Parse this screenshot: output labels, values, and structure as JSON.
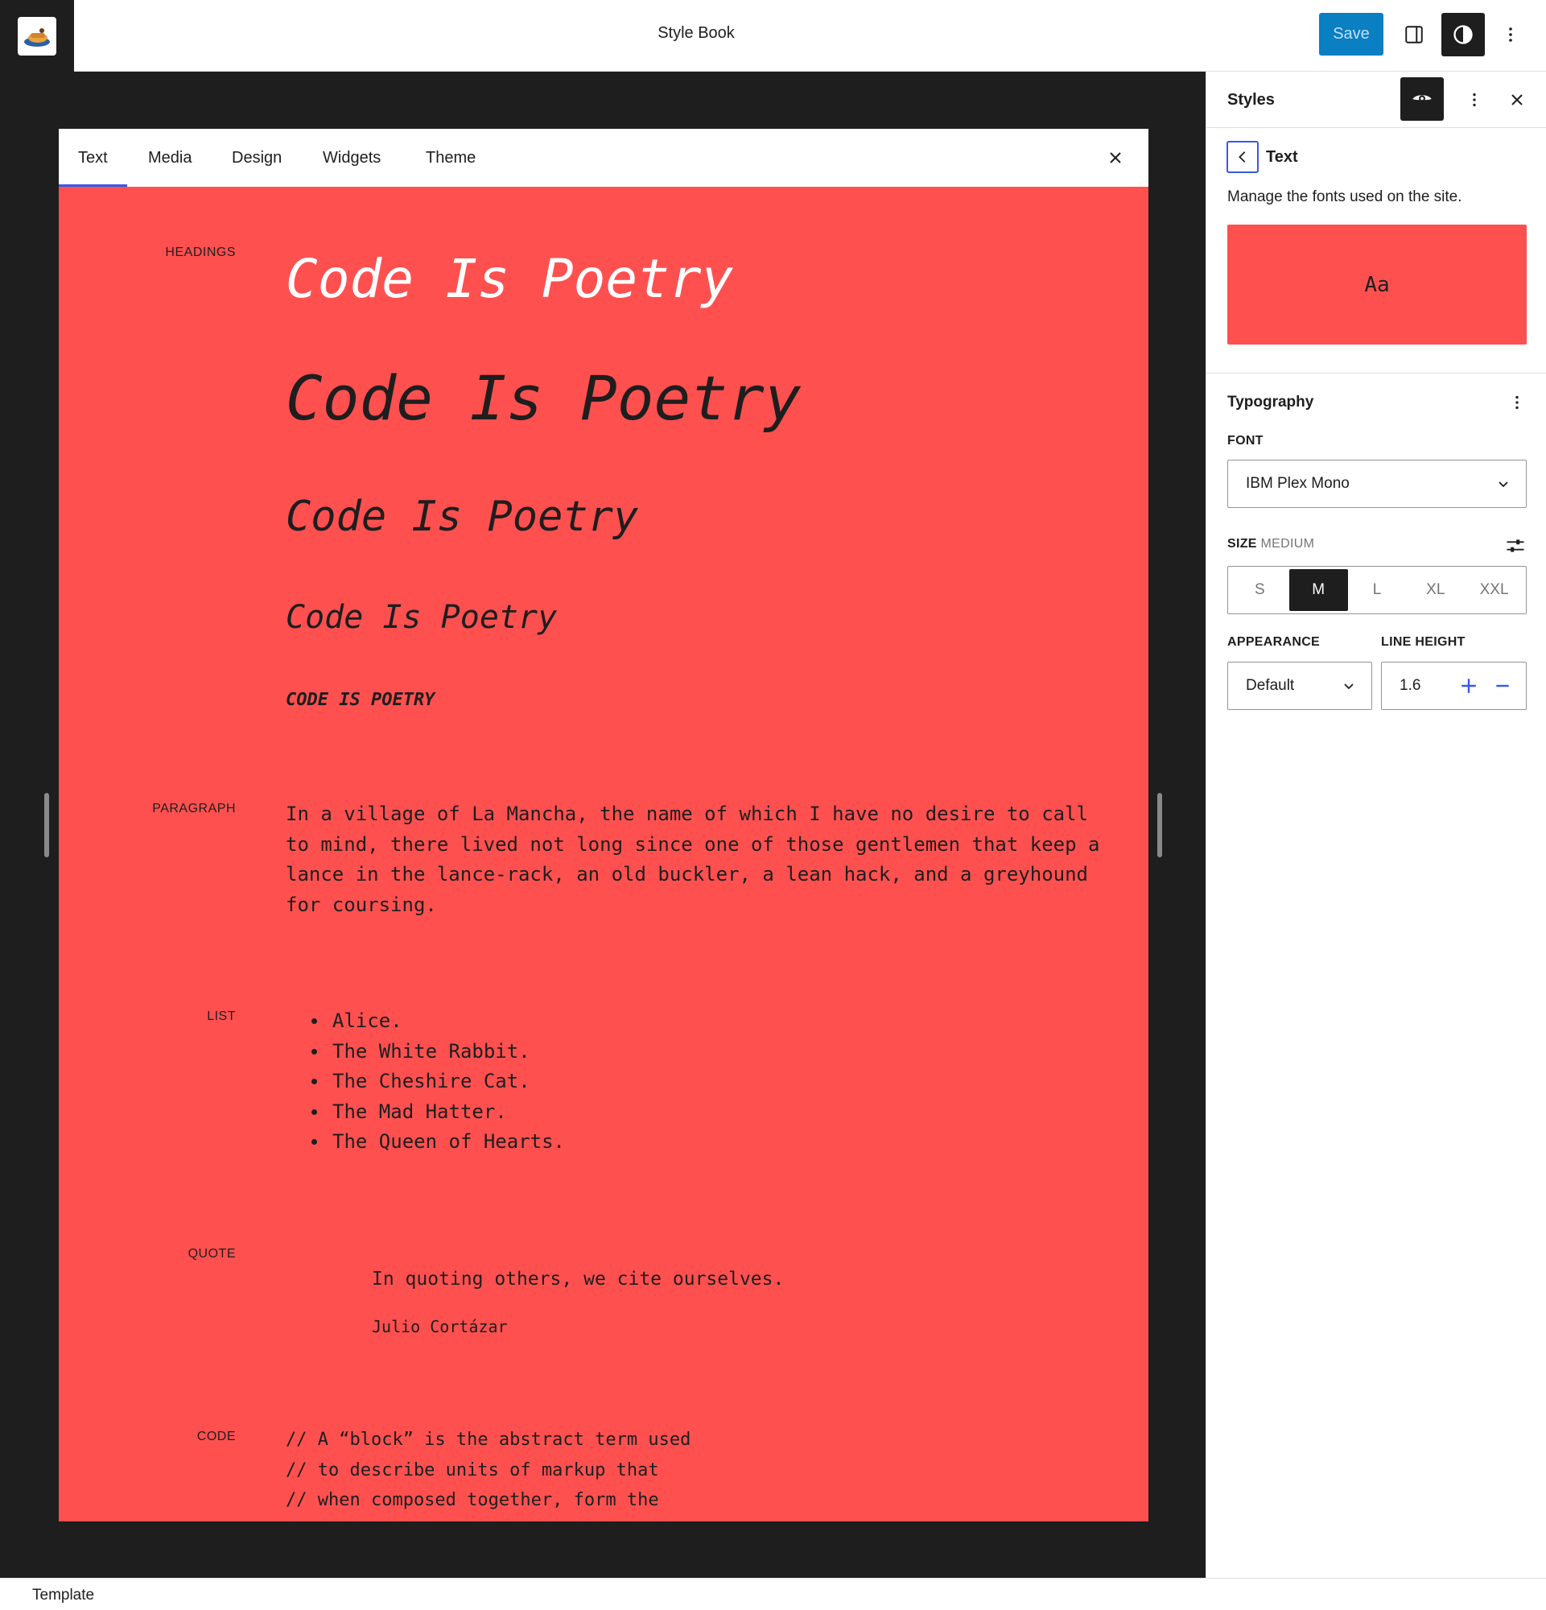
{
  "header": {
    "title": "Style Book",
    "save_label": "Save",
    "icons": [
      "site-logo",
      "sidebar-toggle-icon",
      "styles-contrast-icon",
      "more-vertical-icon"
    ]
  },
  "stylebook": {
    "tabs": [
      "Text",
      "Media",
      "Design",
      "Widgets",
      "Theme"
    ],
    "active_tab": "Text",
    "sections": {
      "headings_label": "HEADINGS",
      "headings": [
        "Code Is Poetry",
        "Code Is Poetry",
        "Code Is Poetry",
        "Code Is Poetry",
        "CODE IS POETRY"
      ],
      "paragraph_label": "PARAGRAPH",
      "paragraph": "In a village of La Mancha, the name of which I have no desire to call to mind, there lived not long since one of those gentlemen that keep a lance in the lance-rack, an old buckler, a lean hack, and a greyhound for coursing.",
      "list_label": "LIST",
      "list": [
        "Alice.",
        "The White Rabbit.",
        "The Cheshire Cat.",
        "The Mad Hatter.",
        "The Queen of Hearts."
      ],
      "quote_label": "QUOTE",
      "quote_text": "In quoting others, we cite ourselves.",
      "quote_cite": "Julio Cortázar",
      "code_label": "CODE",
      "code": "// A “block” is the abstract term used\n// to describe units of markup that\n// when composed together, form the"
    },
    "background_color": "#ff5050"
  },
  "sidebar": {
    "title": "Styles",
    "nav_title": "Text",
    "description": "Manage the fonts used on the site.",
    "preview_text": "Aa",
    "typography": {
      "title": "Typography",
      "font_label": "FONT",
      "font_value": "IBM Plex Mono",
      "size_label": "SIZE",
      "size_value": "MEDIUM",
      "size_options": [
        "S",
        "M",
        "L",
        "XL",
        "XXL"
      ],
      "size_selected": "M",
      "appearance_label": "APPEARANCE",
      "appearance_value": "Default",
      "line_height_label": "LINE HEIGHT",
      "line_height_value": "1.6"
    }
  },
  "statusbar": {
    "label": "Template"
  },
  "colors": {
    "accent": "#3858e9",
    "save_bg": "#0a7fc2",
    "dark": "#1e1e1e"
  }
}
